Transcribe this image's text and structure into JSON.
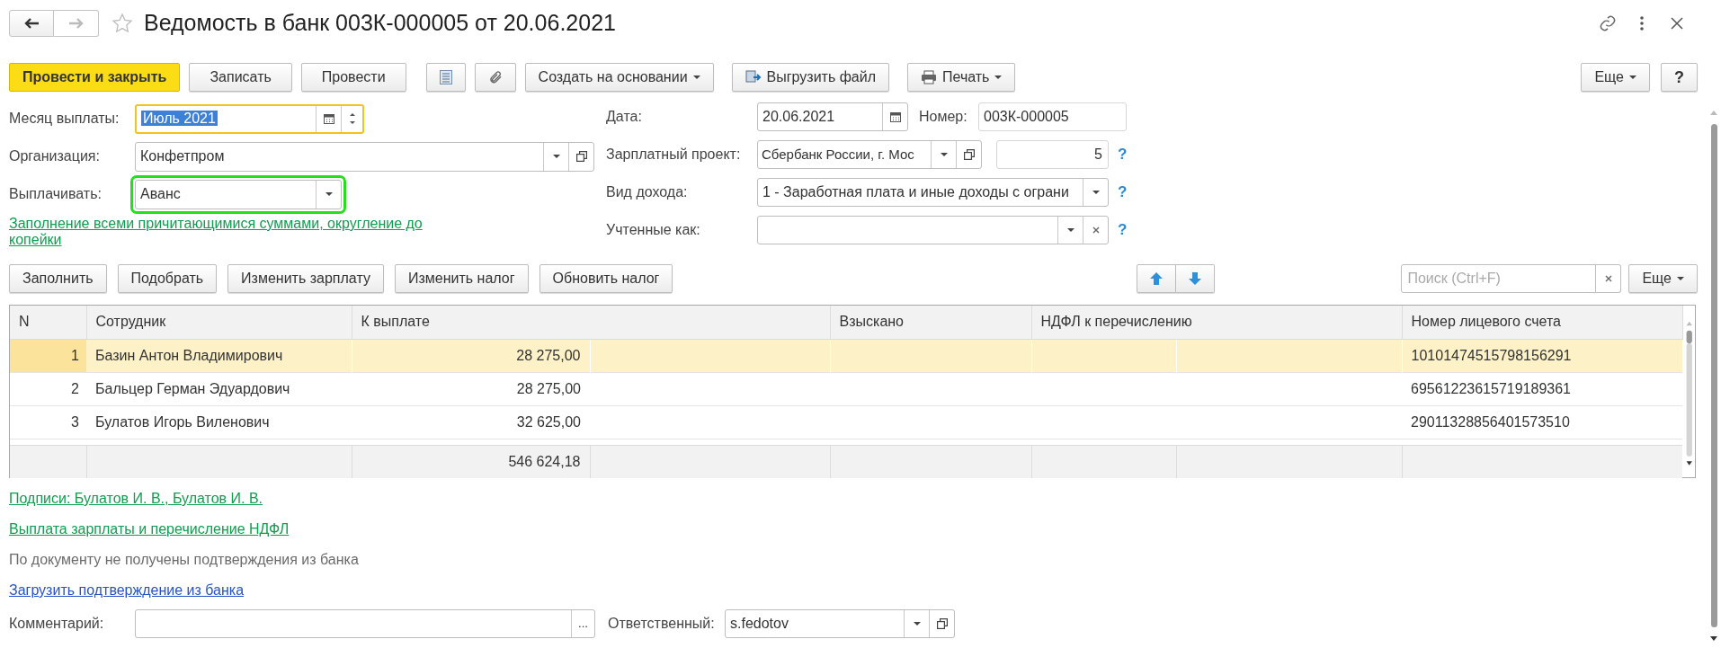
{
  "window": {
    "title": "Ведомость в банк 003К-000005 от 20.06.2021"
  },
  "toolbar": [
    {
      "kind": "primary",
      "label": "Провести и закрыть"
    },
    {
      "kind": "plain",
      "label": "Записать"
    },
    {
      "kind": "plain",
      "label": "Провести"
    },
    {
      "kind": "report"
    },
    {
      "kind": "attach"
    },
    {
      "kind": "menu",
      "label": "Создать на основании"
    },
    {
      "kind": "export",
      "label": "Выгрузить файл"
    },
    {
      "kind": "print",
      "label": "Печать"
    }
  ],
  "toolbar_right": [
    {
      "kind": "menu",
      "label": "Еще"
    },
    {
      "kind": "help",
      "label": "?"
    }
  ],
  "left_fields": [
    {
      "kind": "month",
      "label": "Месяц выплаты:",
      "value": "Июль 2021",
      "focused": true,
      "highlighted": false
    },
    {
      "kind": "select",
      "label": "Организация:",
      "value": "Конфетпром",
      "focused": false,
      "highlighted": false
    },
    {
      "kind": "choice",
      "label": "Выплачивать:",
      "value": "Аванс",
      "focused": false,
      "highlighted": true
    }
  ],
  "fill_link": "Заполнение всеми причитающимися суммами, округление до копейки",
  "date": {
    "label": "Дата:",
    "value": "20.06.2021"
  },
  "number": {
    "label": "Номер:",
    "value": "003К-000005"
  },
  "salary_project": {
    "label": "Зарплатный проект:",
    "value": "Сбербанк России, г. Мос",
    "count": "5",
    "hint": "?"
  },
  "income_type": {
    "label": "Вид дохода:",
    "value": "1 - Заработная плата и иные доходы с ограни",
    "hint": "?"
  },
  "accounted_as": {
    "label": "Учтенные как:",
    "hint": "?"
  },
  "table_toolbar": [
    {
      "label": "Заполнить"
    },
    {
      "label": "Подобрать"
    },
    {
      "label": "Изменить зарплату"
    },
    {
      "label": "Изменить налог"
    },
    {
      "label": "Обновить налог"
    }
  ],
  "search": {
    "placeholder": "Поиск (Ctrl+F)"
  },
  "table_more": {
    "label": "Еще"
  },
  "table": {
    "columns": [
      "N",
      "Сотрудник",
      "К выплате",
      "Взыскано",
      "НДФЛ к перечислению",
      "Номер лицевого счета"
    ],
    "rows": [
      {
        "n": "1",
        "employee": "Базин Антон Владимирович",
        "amount": "28 275,00",
        "account": "10101474515798156291",
        "selected": true
      },
      {
        "n": "2",
        "employee": "Бальцер Герман Эдуардович",
        "amount": "28 275,00",
        "account": "69561223615719189361",
        "selected": false
      },
      {
        "n": "3",
        "employee": "Булатов Игорь Виленович",
        "amount": "32 625,00",
        "account": "29011328856401573510",
        "selected": false
      }
    ],
    "total": "546 624,18"
  },
  "links": [
    {
      "kind": "action",
      "text": "Подписи: Булатов И. В., Булатов И. В."
    },
    {
      "kind": "action",
      "text": "Выплата зарплаты и перечисление НДФЛ"
    },
    {
      "kind": "note",
      "text": "По документу не получены подтверждения из банка"
    },
    {
      "kind": "link",
      "text": "Загрузить подтверждение из банка"
    }
  ],
  "comment": {
    "label": "Комментарий:",
    "button": "..."
  },
  "responsible": {
    "label": "Ответственный:",
    "value": "s.fedotov"
  }
}
